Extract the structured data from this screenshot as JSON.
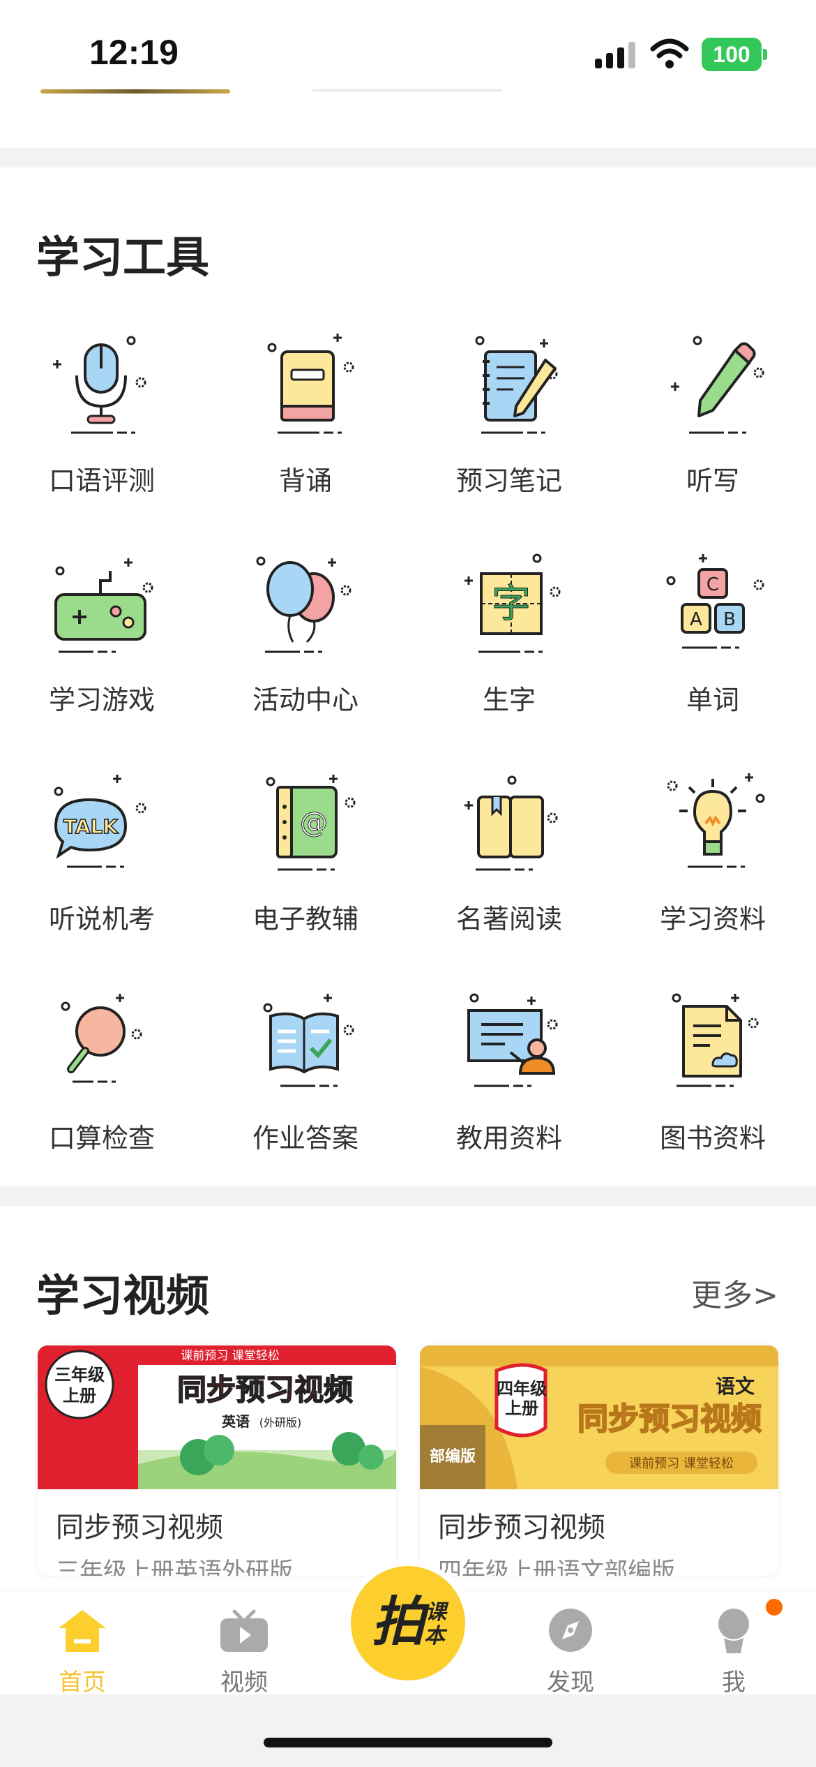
{
  "status_bar": {
    "time": "12:19",
    "battery": "100"
  },
  "tools_section": {
    "title": "学习工具",
    "items": [
      {
        "label": "口语评测",
        "icon": "microphone-icon"
      },
      {
        "label": "背诵",
        "icon": "book-icon"
      },
      {
        "label": "预习笔记",
        "icon": "notebook-pencil-icon"
      },
      {
        "label": "听写",
        "icon": "pencil-icon"
      },
      {
        "label": "学习游戏",
        "icon": "gamepad-icon"
      },
      {
        "label": "活动中心",
        "icon": "balloons-icon"
      },
      {
        "label": "生字",
        "icon": "character-grid-icon",
        "glyph": "字"
      },
      {
        "label": "单词",
        "icon": "abc-blocks-icon",
        "glyph_a": "C",
        "glyph_b": "A",
        "glyph_c": "B"
      },
      {
        "label": "听说机考",
        "icon": "talk-bubble-icon",
        "glyph": "TALK"
      },
      {
        "label": "电子教辅",
        "icon": "e-book-icon",
        "glyph": "@"
      },
      {
        "label": "名著阅读",
        "icon": "open-book-icon"
      },
      {
        "label": "学习资料",
        "icon": "lightbulb-icon"
      },
      {
        "label": "口算检查",
        "icon": "magnifier-icon"
      },
      {
        "label": "作业答案",
        "icon": "answer-book-icon"
      },
      {
        "label": "教用资料",
        "icon": "teacher-board-icon"
      },
      {
        "label": "图书资料",
        "icon": "document-cloud-icon"
      }
    ]
  },
  "videos_section": {
    "title": "学习视频",
    "more": "更多>",
    "cards": [
      {
        "title": "同步预习视频",
        "subtitle": "三年级上册英语外研版",
        "thumb": {
          "grade": "三年级",
          "volume": "上册",
          "banner": "课前预习  课堂轻松",
          "headline": "同步预习视频",
          "subject": "英语",
          "edition": "(外研版)"
        }
      },
      {
        "title": "同步预习视频",
        "subtitle": "四年级上册语文部编版",
        "thumb": {
          "grade": "四年级",
          "volume": "上册",
          "subject": "语文",
          "headline": "同步预习视频",
          "edition": "部编版",
          "banner": "课前预习 课堂轻松"
        }
      }
    ]
  },
  "tab_bar": {
    "tabs": [
      {
        "label": "首页",
        "icon": "home-icon",
        "active": true
      },
      {
        "label": "视频",
        "icon": "tv-icon",
        "active": false
      },
      {
        "label": "拍课本",
        "icon": "camera-book-icon",
        "active": false
      },
      {
        "label": "发现",
        "icon": "compass-icon",
        "active": false
      },
      {
        "label": "我",
        "icon": "profile-icon",
        "active": false
      }
    ],
    "snap_glyph": "拍",
    "snap_small_a": "课",
    "snap_small_b": "本"
  },
  "colors": {
    "accent": "#f6c234",
    "snap_button": "#fccf2f",
    "badge": "#ff6a00",
    "battery": "#34c759"
  }
}
